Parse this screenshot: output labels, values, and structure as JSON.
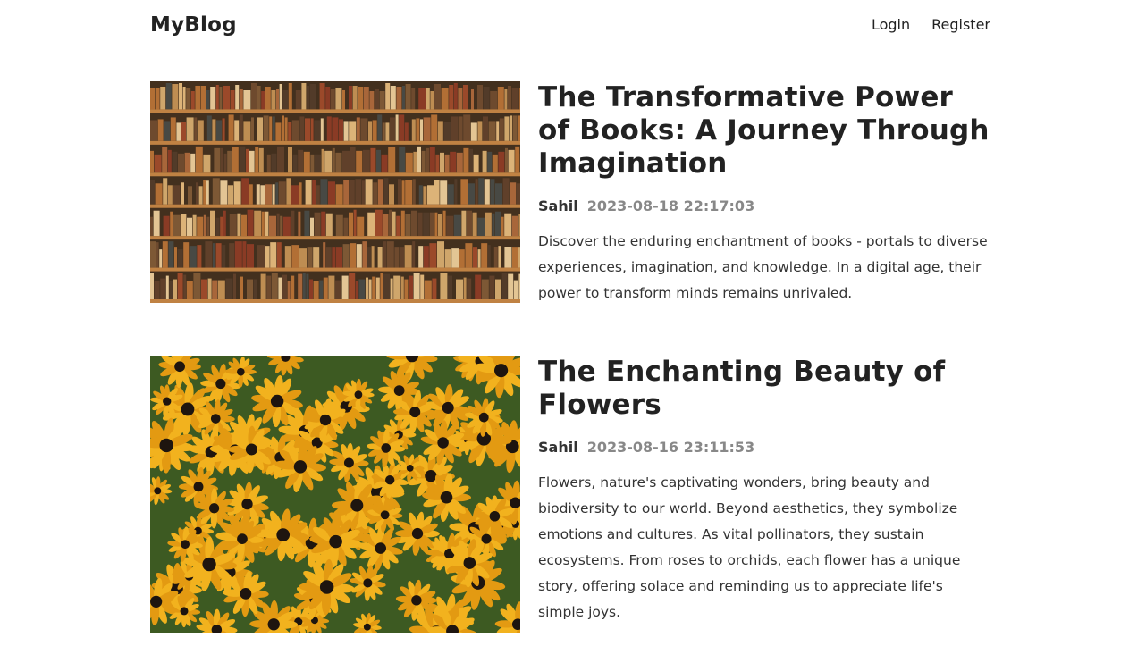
{
  "header": {
    "logo": "MyBlog",
    "nav": [
      {
        "label": "Login"
      },
      {
        "label": "Register"
      }
    ]
  },
  "posts": [
    {
      "title": "The Transformative Power of Books: A Journey Through Imagination",
      "author": "Sahil",
      "date": "2023-08-18 22:17:03",
      "summary": "Discover the enduring enchantment of books - portals to diverse experiences, imagination, and knowledge. In a digital age, their power to transform minds remains unrivaled.",
      "image": "bookshelf-image"
    },
    {
      "title": "The Enchanting Beauty of Flowers",
      "author": "Sahil",
      "date": "2023-08-16 23:11:53",
      "summary": "Flowers, nature's captivating wonders, bring beauty and biodiversity to our world. Beyond aesthetics, they symbolize emotions and cultures. As vital pollinators, they sustain ecosystems. From roses to orchids, each flower has a unique story, offering solace and reminding us to appreciate life's simple joys.",
      "image": "flowers-image"
    }
  ]
}
